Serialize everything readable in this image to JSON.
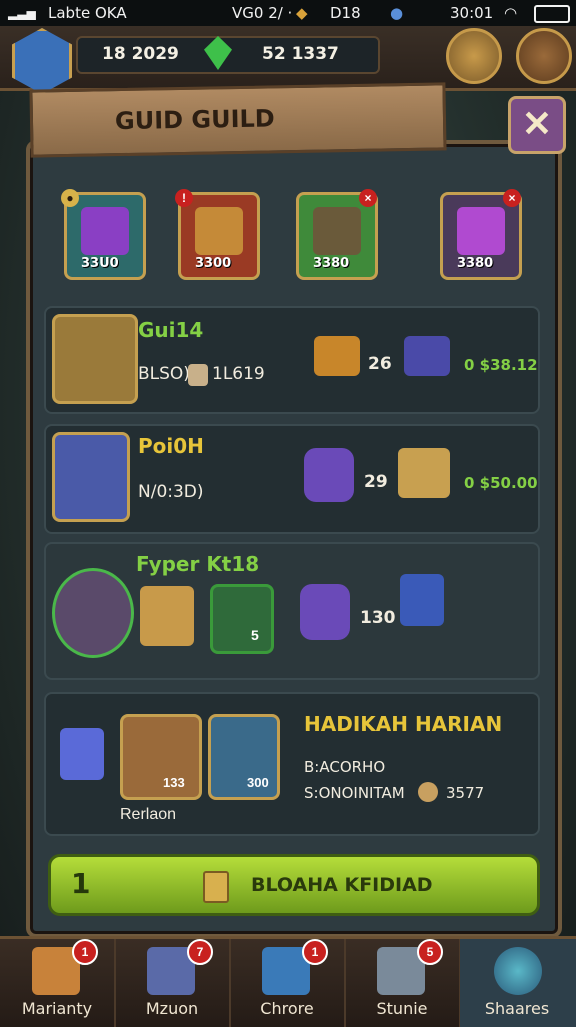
{
  "status_bar": {
    "carrier": "Labte OKA",
    "center": "VG0 2/ · ",
    "center2": "D18",
    "time": "30:01"
  },
  "resources": {
    "left_value": "18 2029",
    "right_value": "52 1337"
  },
  "panel": {
    "title": "GUID GUILD",
    "close_glyph": "✕"
  },
  "featured_items": [
    {
      "value": "33U0"
    },
    {
      "value": "3300"
    },
    {
      "value": "3380"
    },
    {
      "value": "3380"
    }
  ],
  "offers": [
    {
      "title": "Gui14",
      "subtitle_prefix": "BLSO)",
      "subtitle_value": "1L619",
      "qty": "26",
      "price": "0 $38.12"
    },
    {
      "title": "Poi0H",
      "subtitle_prefix": "N/0:3D)",
      "qty": "29",
      "price": "0 $50.00"
    },
    {
      "title": "Fyper Kt18",
      "card_value": "5",
      "qty": "130"
    },
    {
      "title": "HADIKAH HARIAN",
      "line1": "B:ACORHO",
      "line2": "S:ONOINITAM",
      "line2_value": "3577",
      "caption": "Rerlaon",
      "card_value1": "133",
      "card_value2": "300"
    }
  ],
  "cta": {
    "count": "1",
    "label": "BLOAHA KFIDIAD"
  },
  "bottom_nav": [
    {
      "label": "Marianty",
      "badge": "1"
    },
    {
      "label": "Mzuon",
      "badge": "7"
    },
    {
      "label": "Chrore",
      "badge": "1"
    },
    {
      "label": "Stunie",
      "badge": "5"
    },
    {
      "label": "Shaares",
      "badge": ""
    }
  ],
  "colors": {
    "accent_green": "#84d045",
    "gold_frame": "#c5a050",
    "panel": "#2e3b40",
    "title_yellow": "#e7c53a"
  }
}
